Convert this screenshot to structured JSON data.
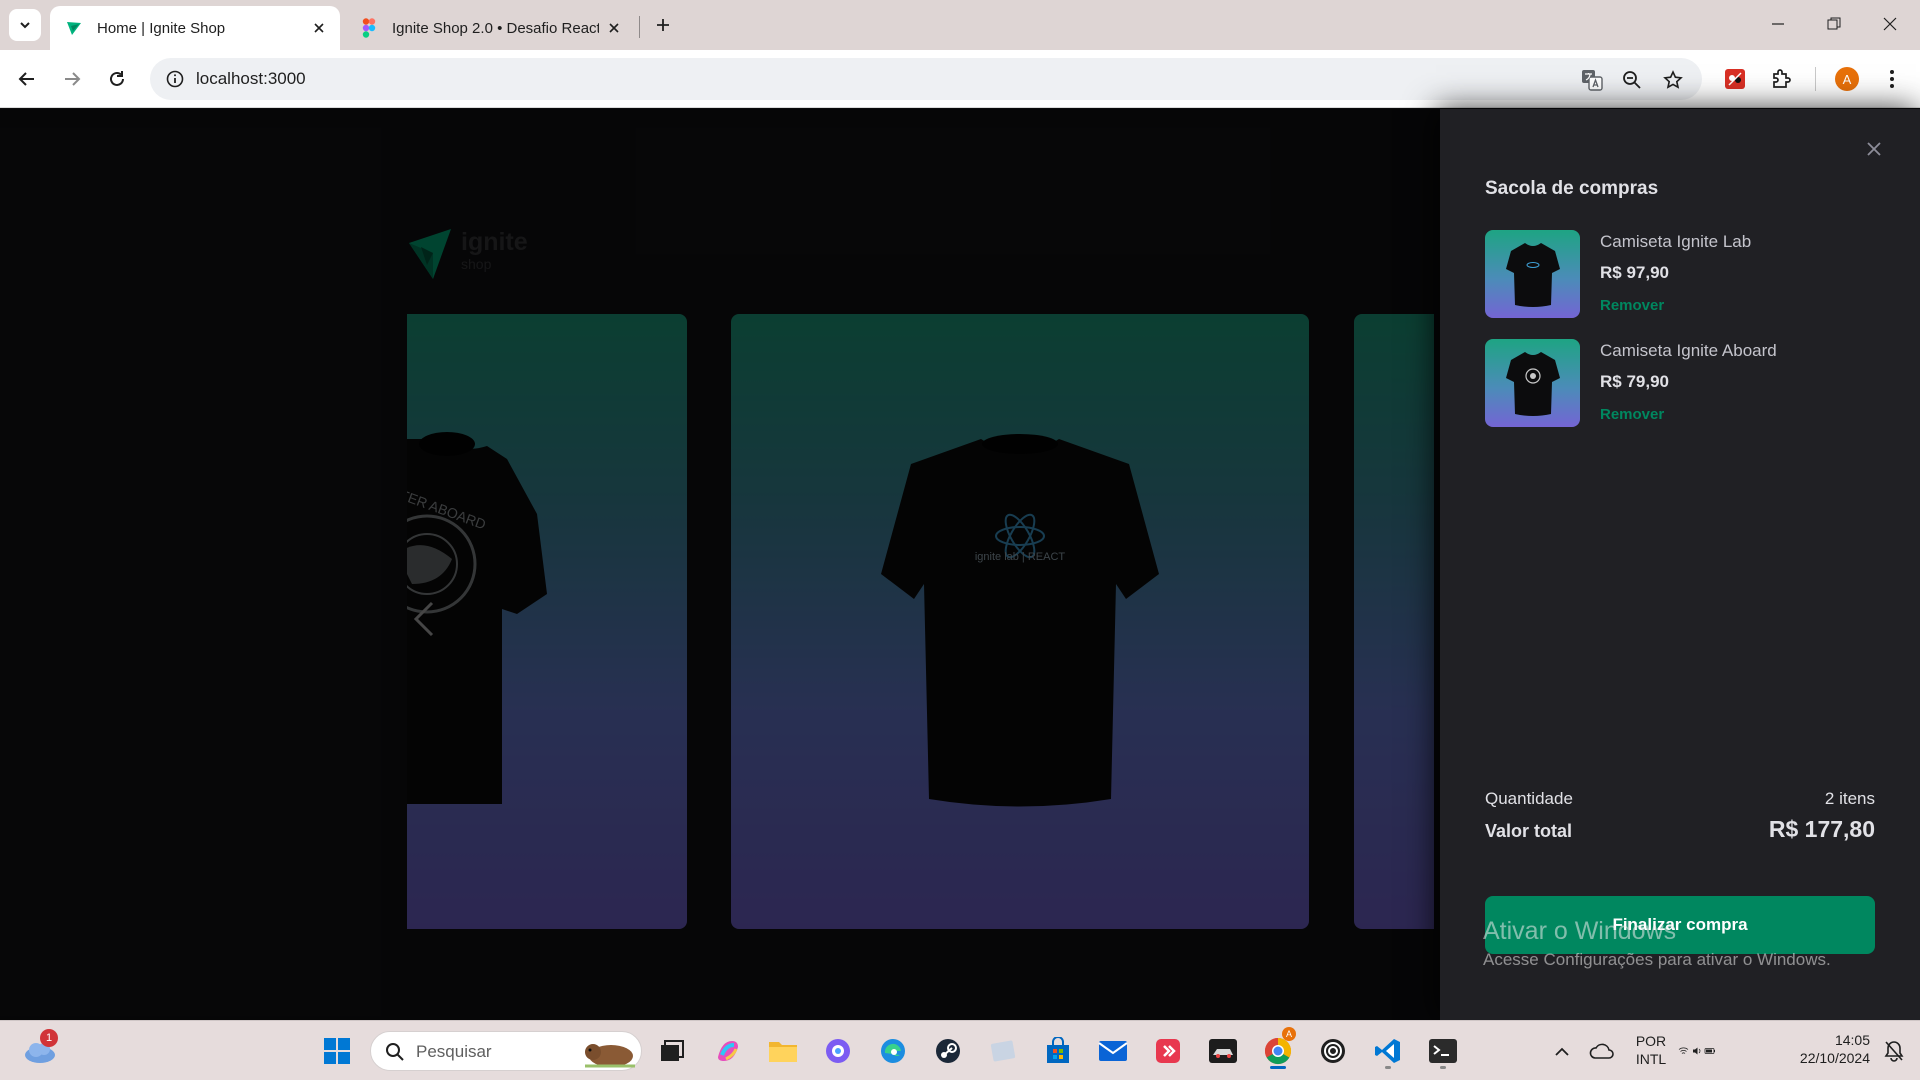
{
  "browser": {
    "tabs": [
      {
        "title": "Home | Ignite Shop",
        "active": true
      },
      {
        "title": "Ignite Shop 2.0 • Desafio React",
        "active": false
      }
    ],
    "url": "localhost:3000",
    "profile_initial": "A"
  },
  "logo": {
    "word1": "ignite",
    "word2": "shop"
  },
  "cart": {
    "title": "Sacola de compras",
    "items": [
      {
        "name": "Camiseta Ignite Lab",
        "price": "R$ 97,90",
        "remove_label": "Remover"
      },
      {
        "name": "Camiseta Ignite Aboard",
        "price": "R$ 79,90",
        "remove_label": "Remover"
      }
    ],
    "quantity_label": "Quantidade",
    "quantity_value": "2 itens",
    "total_label": "Valor total",
    "total_value": "R$ 177,80",
    "checkout_label": "Finalizar compra"
  },
  "watermark": {
    "title": "Ativar o Windows",
    "subtitle": "Acesse Configurações para ativar o Windows."
  },
  "taskbar": {
    "search_placeholder": "Pesquisar",
    "weather_badge": "1",
    "language_top": "POR",
    "language_bottom": "INTL",
    "time": "14:05",
    "date": "22/10/2024"
  },
  "colors": {
    "accent_green": "#00875f",
    "drawer_bg": "#202024",
    "card_gradient_top": "#1ea483",
    "card_gradient_bottom": "#7465d4"
  }
}
